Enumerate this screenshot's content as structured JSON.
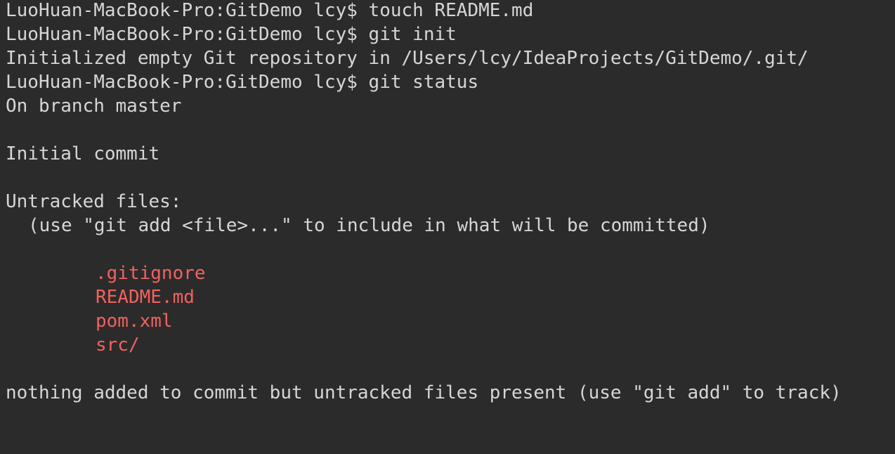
{
  "terminal": {
    "lines": {
      "l1": "LuoHuan-MacBook-Pro:GitDemo lcy$ touch README.md",
      "l2": "LuoHuan-MacBook-Pro:GitDemo lcy$ git init",
      "l3": "Initialized empty Git repository in /Users/lcy/IdeaProjects/GitDemo/.git/",
      "l4": "LuoHuan-MacBook-Pro:GitDemo lcy$ git status",
      "l5": "On branch master",
      "l7": "Initial commit",
      "l9": "Untracked files:",
      "l10": "(use \"git add <file>...\" to include in what will be committed)",
      "l17": "nothing added to commit but untracked files present (use \"git add\" to track)"
    },
    "untracked_files": [
      ".gitignore",
      "README.md",
      "pom.xml",
      "src/"
    ],
    "colors": {
      "background": "#2b2b2b",
      "text": "#d6d6d6",
      "untracked": "#f2625f"
    }
  }
}
